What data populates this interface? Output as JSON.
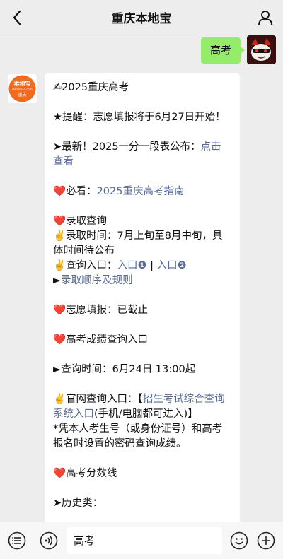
{
  "navbar": {
    "title": "重庆本地宝",
    "back_icon": "chevron-left-icon",
    "profile_icon": "person-icon"
  },
  "outgoing": {
    "text": "高考"
  },
  "bot": {
    "avatar_top": "本地宝",
    "avatar_mid": "Bendibao.com",
    "avatar_bottom": "重庆"
  },
  "message": {
    "title_emoji": "✍",
    "title": "2025重庆高考",
    "reminder": "★提醒：志愿填报将于6月27日开始！",
    "latest_prefix": "➤最新！2025一分一段表公布：",
    "latest_link": "点击查看",
    "must_prefix": "必看：",
    "must_link": "2025重庆高考指南",
    "admission_title": "录取查询",
    "admission_time": "录取时间：7月上旬至8月中旬，具体时间待公布",
    "admission_entry_prefix": "查询入口：",
    "entry1": "入口❶",
    "sep": " | ",
    "entry2": "入口❷",
    "order_prefix": "►",
    "order_link": "录取顺序及规则",
    "volunteer": "志愿填报：已截止",
    "score_title": "高考成绩查询入口",
    "query_time": "►查询时间：6月24日 13:00起",
    "official_prefix": "官网查询入口：【",
    "official_link": "招生考试综合查询系统入口",
    "official_suffix": "(手机/电脑都可进入)】",
    "note": "*凭本人考生号（或身份证号）和高考报名时设置的密码查询成绩。",
    "cutoff_title": "高考分数线",
    "history": "➤历史类："
  },
  "inputbar": {
    "menu_icon": "menu-list-icon",
    "voice_icon": "voice-icon",
    "input_value": "高考",
    "emoji_icon": "emoji-icon",
    "plus_icon": "plus-icon"
  },
  "colors": {
    "background": "#ededed",
    "outgoing_bubble": "#95ec69",
    "link": "#576b95",
    "heart": "#e02020",
    "bot_avatar_orange": "#f26a1b"
  }
}
